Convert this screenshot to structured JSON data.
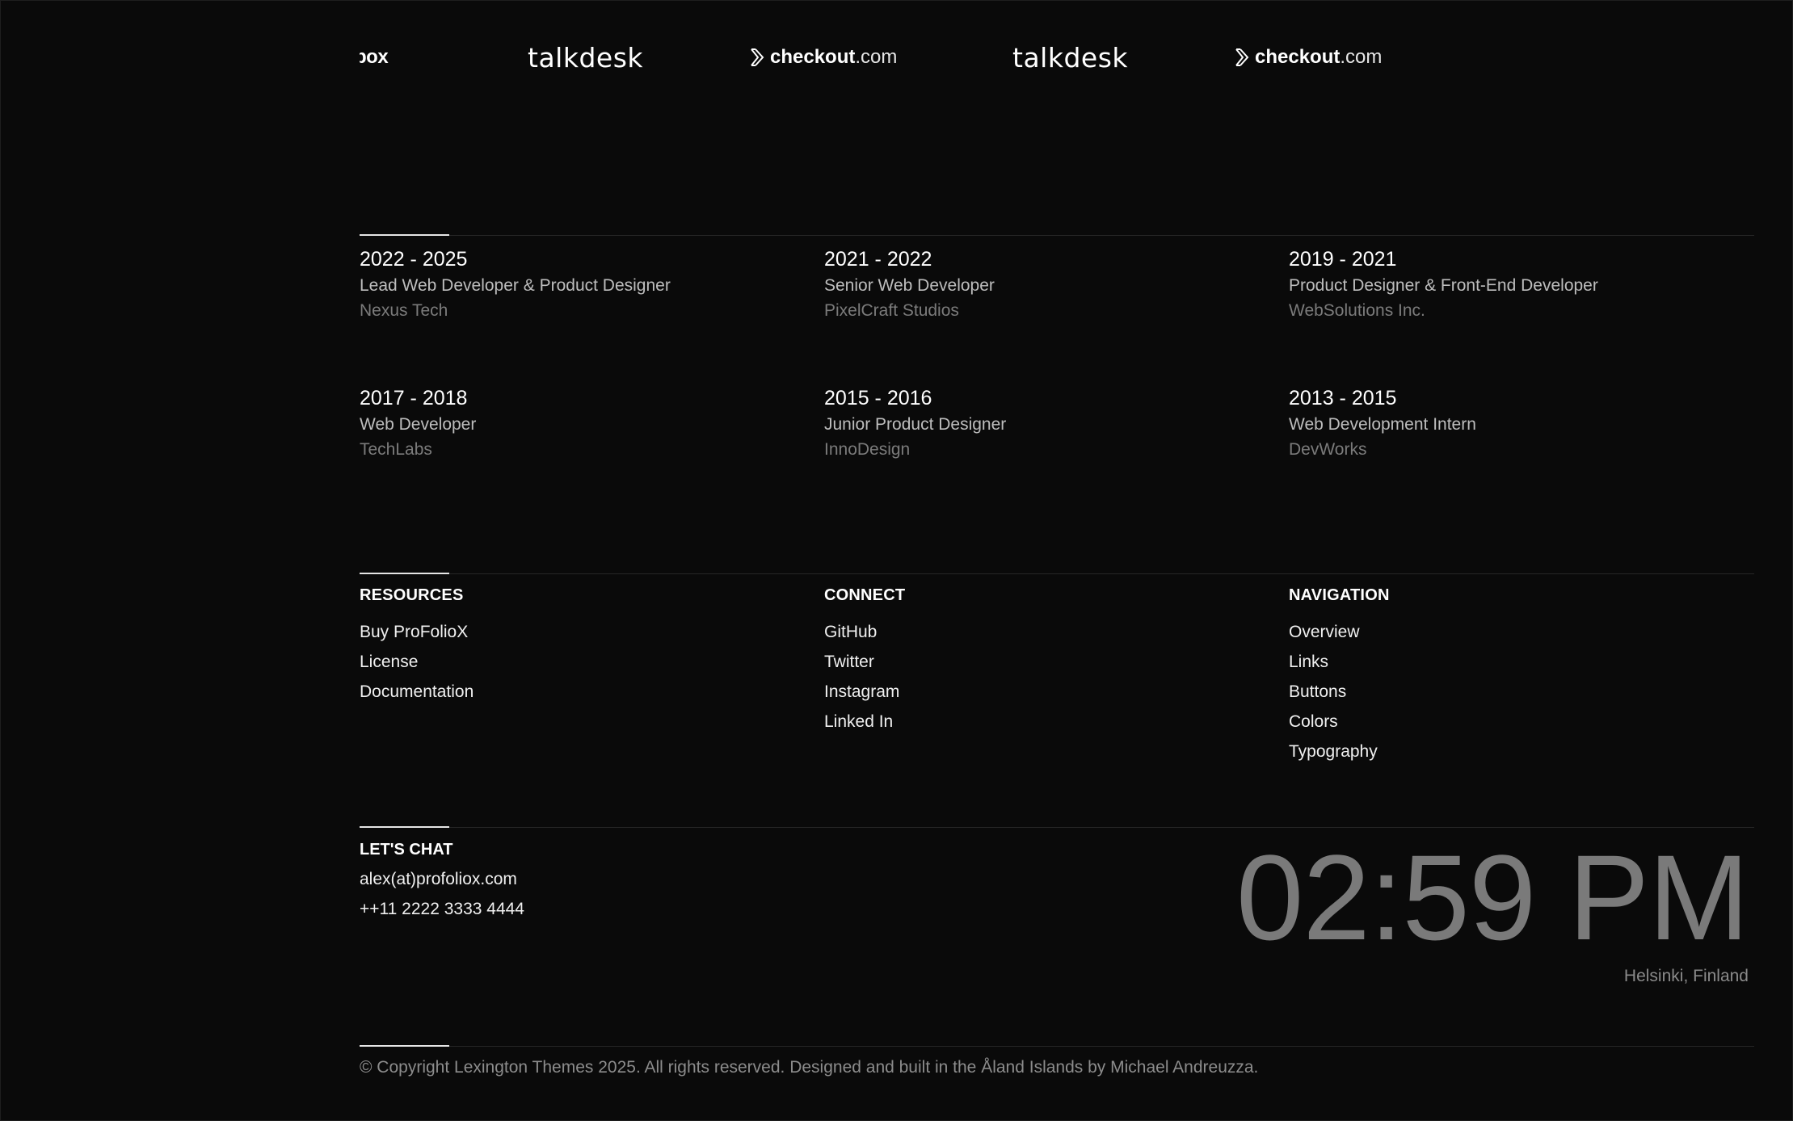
{
  "logos": {
    "items": [
      {
        "name": "box-logo",
        "text": "box"
      },
      {
        "name": "talkdesk-logo",
        "text": "talkdesk"
      },
      {
        "name": "checkout-logo",
        "bold": "checkout",
        "thin": ".com"
      },
      {
        "name": "talkdesk-logo",
        "text": "talkdesk"
      },
      {
        "name": "checkout-logo",
        "bold": "checkout",
        "thin": ".com"
      }
    ]
  },
  "experience": [
    {
      "years": "2022 - 2025",
      "role": "Lead Web Developer & Product Designer",
      "company": "Nexus Tech"
    },
    {
      "years": "2021 - 2022",
      "role": "Senior Web Developer",
      "company": "PixelCraft Studios"
    },
    {
      "years": "2019 - 2021",
      "role": "Product Designer & Front-End Developer",
      "company": "WebSolutions Inc."
    },
    {
      "years": "2017 - 2018",
      "role": "Web Developer",
      "company": "TechLabs"
    },
    {
      "years": "2015 - 2016",
      "role": "Junior Product Designer",
      "company": "InnoDesign"
    },
    {
      "years": "2013 - 2015",
      "role": "Web Development Intern",
      "company": "DevWorks"
    }
  ],
  "footer": {
    "resources": {
      "heading": "RESOURCES",
      "links": [
        "Buy ProFolioX",
        "License",
        "Documentation"
      ]
    },
    "connect": {
      "heading": "CONNECT",
      "links": [
        "GitHub",
        "Twitter",
        "Instagram",
        "Linked In"
      ]
    },
    "navigation": {
      "heading": "NAVIGATION",
      "links": [
        "Overview",
        "Links",
        "Buttons",
        "Colors",
        "Typography"
      ]
    }
  },
  "chat": {
    "heading": "LET'S CHAT",
    "email": "alex(at)profoliox.com",
    "phone": "++11 2222 3333 4444"
  },
  "clock": {
    "time": "02:59 PM",
    "location": "Helsinki, Finland"
  },
  "copyright": "© Copyright Lexington Themes 2025. All rights reserved. Designed and built in the Åland Islands by Michael Andreuzza.",
  "colors": {
    "background": "#0a0a0a",
    "text": "#f2f2f2",
    "muted": "#7b7b7b",
    "clock": "#7a7a7a"
  }
}
